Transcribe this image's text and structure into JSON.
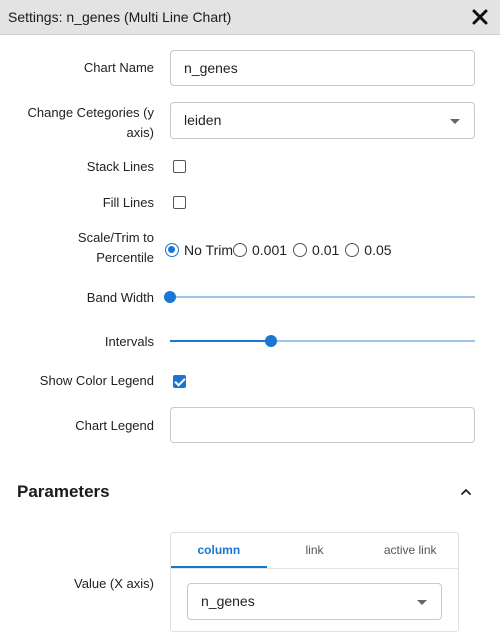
{
  "window": {
    "title": "Settings: n_genes (Multi Line Chart)",
    "close_icon": "close-icon"
  },
  "form": {
    "chart_name_label": "Chart Name",
    "chart_name_value": "n_genes",
    "categories_label_line1": "Change Cetegories (y",
    "categories_label_line2": "axis)",
    "categories_value": "leiden",
    "stack_lines_label": "Stack Lines",
    "stack_lines_checked": false,
    "fill_lines_label": "Fill Lines",
    "fill_lines_checked": false,
    "scale_label_line1": "Scale/Trim to",
    "scale_label_line2": "Percentile",
    "scale_options": [
      "No Trim",
      "0.001",
      "0.01",
      "0.05"
    ],
    "scale_selected": "No Trim",
    "band_width_label": "Band Width",
    "band_width_fraction": 0.0,
    "intervals_label": "Intervals",
    "intervals_fraction": 0.33,
    "show_color_legend_label": "Show Color Legend",
    "show_color_legend_checked": true,
    "chart_legend_label": "Chart Legend",
    "chart_legend_value": ""
  },
  "parameters": {
    "title": "Parameters",
    "collapse_icon": "chevron-up-icon",
    "value_label": "Value (X axis)",
    "tabs": [
      "column",
      "link",
      "active link"
    ],
    "active_tab": "column",
    "value_selected": "n_genes"
  },
  "colors": {
    "accent": "#1976d2",
    "titlebar_bg": "#e3e3e3"
  }
}
